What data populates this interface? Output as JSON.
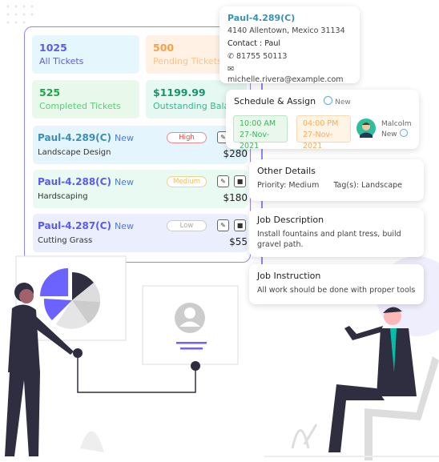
{
  "stats": [
    {
      "value": "1025",
      "label": "All Tickets",
      "color": "#5a5af0",
      "bg": "#e6f6fd"
    },
    {
      "value": "500",
      "label": "Pending Tickets",
      "color": "#f7a04a",
      "bg": "#fff1e3"
    },
    {
      "value": "525",
      "label": "Completed Tickets",
      "color": "#20a44a",
      "bg": "#e8f9ec"
    },
    {
      "value": "$1199.99",
      "label": "Outstanding Balance",
      "color": "#13976a",
      "bg": "#e6f8f2"
    }
  ],
  "tickets": [
    {
      "id": "Paul-4.289(C)",
      "status": "New",
      "desc": "Landscape Design",
      "priority": "High",
      "amount": "$280"
    },
    {
      "id": "Paul-4.288(C)",
      "status": "New",
      "desc": "Hardscaping",
      "priority": "Medium",
      "amount": "$180"
    },
    {
      "id": "Paul-4.287(C)",
      "status": "New",
      "desc": "Cutting Grass",
      "priority": "Low",
      "amount": "$55"
    }
  ],
  "contact": {
    "id": "Paul-4.289(C)",
    "address": "4140 Allentown, Mexico 31134",
    "contact": "Contact  : Paul",
    "phone": "81755 50113",
    "email": "michelle.rivera@example.com"
  },
  "schedule": {
    "title": "Schedule & Assign",
    "status": "New",
    "start_time": "10:00 AM",
    "start_date": "27-Nov-2021",
    "end_time": "04:00 PM",
    "end_date": "27-Nov-2021",
    "assignee": "Malcolm",
    "assignee_status": "New"
  },
  "other": {
    "title": "Other Details",
    "priority": "Priority: Medium",
    "tags": "Tag(s): Landscape"
  },
  "job_description": {
    "title": "Job Description",
    "text": "Install fountains and plant tress, build gravel path."
  },
  "job_instruction": {
    "title": "Job Instruction",
    "text": "All work should be done with proper tools"
  }
}
